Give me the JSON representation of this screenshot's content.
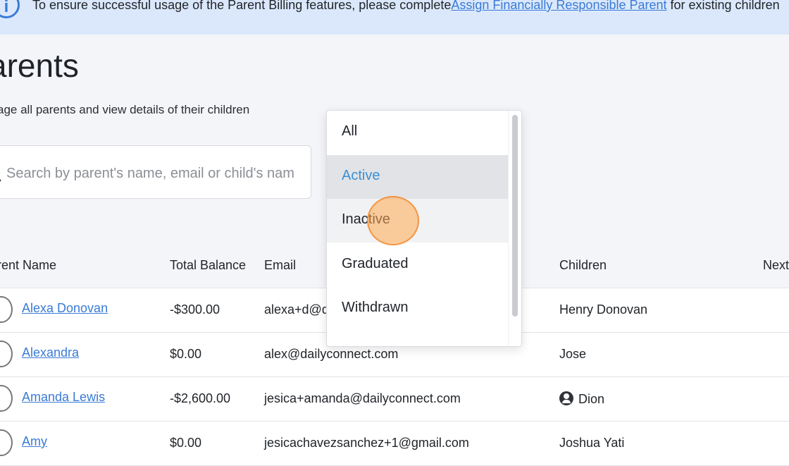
{
  "banner": {
    "icon": "info-icon",
    "text_before": "To ensure successful usage of the Parent Billing features, please complete",
    "link_text": "Assign Financially Responsible Parent",
    "text_after": " for existing children"
  },
  "page": {
    "title": "arents",
    "subtitle": "age all parents and view details of their children"
  },
  "search": {
    "placeholder": "Search by parent's name, email or child's nam",
    "icon": "search-icon"
  },
  "table": {
    "headers": {
      "parent_name": "rent Name",
      "total_balance": "Total Balance",
      "email": "Email",
      "children": "Children",
      "next": "Next"
    },
    "rows": [
      {
        "name": "Alexa Donovan",
        "balance": "-$300.00",
        "email": "alexa+d@d",
        "children": "Henry Donovan"
      },
      {
        "name": "Alexandra",
        "balance": "$0.00",
        "email": "alex@dailyconnect.com",
        "children": "Jose"
      },
      {
        "name": "Amanda Lewis",
        "balance": "-$2,600.00",
        "email": "jesica+amanda@dailyconnect.com",
        "children": "Dion"
      },
      {
        "name": "Amy",
        "balance": "$0.00",
        "email": "jesicachavezsanchez+1@gmail.com",
        "children": "Joshua Yati"
      }
    ]
  },
  "status_dropdown": {
    "options": [
      "All",
      "Active",
      "Inactive",
      "Graduated",
      "Withdrawn"
    ],
    "selected": "Active",
    "hovered": "Inactive"
  },
  "colors": {
    "accent": "#3a7bd5",
    "banner_bg": "#dbe8fc",
    "selected_text": "#3a8fd6"
  }
}
